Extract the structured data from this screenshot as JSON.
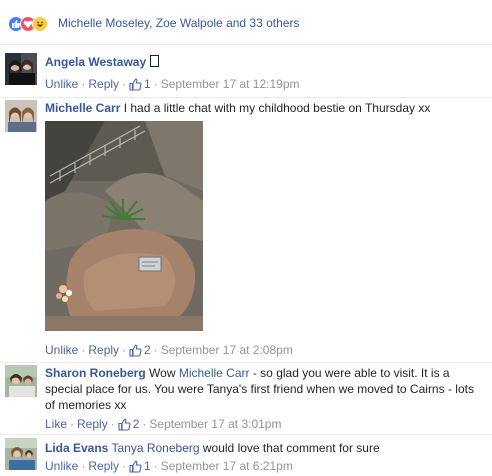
{
  "reactions": {
    "icons": [
      "like-icon",
      "love-icon",
      "haha-icon"
    ],
    "summary": "Michelle Moseley, Zoe Walpole and 33 others"
  },
  "comments": [
    {
      "author": "Angela Westaway",
      "text": "",
      "actions": {
        "primary": "Unlike",
        "reply": "Reply"
      },
      "likes": "1",
      "timestamp": "September 17 at 12:19pm"
    },
    {
      "author": "Michelle Carr",
      "text": "I had a little chat with my childhood bestie on Thursday xx",
      "actions": {
        "primary": "Unlike",
        "reply": "Reply"
      },
      "likes": "2",
      "timestamp": "September 17 at 2:08pm"
    },
    {
      "author": "Sharon Roneberg",
      "text_before": "Wow ",
      "mention": "Michelle Carr",
      "text_after": " - so glad you were able to visit. It is a special place for us. You were Tanya's first friend when we moved to Cairns - lots of memories xx",
      "actions": {
        "primary": "Like",
        "reply": "Reply"
      },
      "likes": "2",
      "timestamp": "September 17 at 3:01pm"
    },
    {
      "author": "Lida Evans",
      "mention": "Tanya Roneberg",
      "text_after": " would love that comment for sure",
      "actions": {
        "primary": "Unlike",
        "reply": "Reply"
      },
      "likes": "1",
      "timestamp": "September 17 at 6:21pm"
    }
  ],
  "colors": {
    "link": "#365899",
    "action": "#4b67a1",
    "meta": "#90949c",
    "like": "#4080ff",
    "love": "#f25268",
    "haha": "#fccb43"
  },
  "separator": "·"
}
